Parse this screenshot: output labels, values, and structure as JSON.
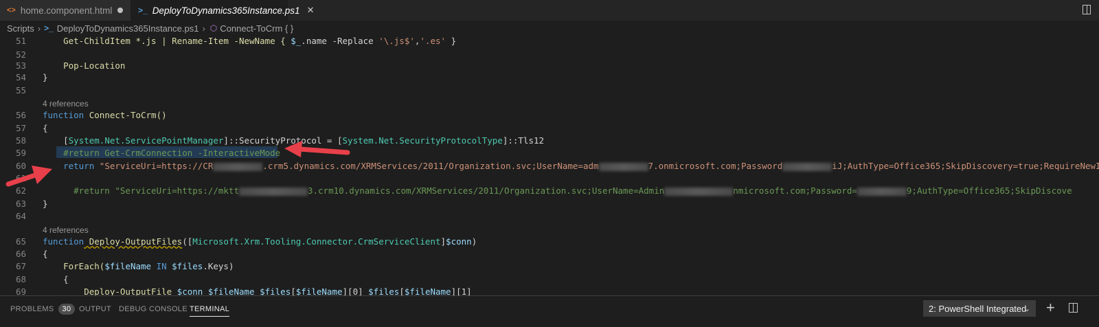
{
  "tabs": [
    {
      "label": "home.component.html",
      "icon": "html-file-icon",
      "modified": true
    },
    {
      "label": "DeployToDynamics365Instance.ps1",
      "icon": "powershell-file-icon",
      "active": true
    }
  ],
  "breadcrumb": {
    "items": [
      "Scripts",
      "DeployToDynamics365Instance.ps1",
      "Connect-ToCrm { }"
    ]
  },
  "code": {
    "refs": "4 references",
    "l51": "51",
    "l52": "52",
    "l53": "53",
    "l54": "54",
    "l55": "55",
    "l56": "56",
    "l57": "57",
    "l58": "58",
    "l59": "59",
    "l60": "60",
    "l61": "61",
    "l62": "62",
    "l63": "63",
    "l64": "64",
    "l65": "65",
    "l66": "66",
    "l67": "67",
    "l68": "68",
    "l69": "69",
    "t51a": "    Get-ChildItem *.js | Rename-Item -NewName { ",
    "t51b": "$_",
    "t51c": ".name -Replace ",
    "t51d": "'\\.js$'",
    "t51e": ",",
    "t51f": "'.es'",
    "t51g": " }",
    "t53": "    Pop-Location",
    "t54": "}",
    "t56a": "function",
    "t56b": " Connect-ToCrm()",
    "t57": "{",
    "t58a": "    [",
    "t58b": "System.Net.ServicePointManager",
    "t58c": "]::SecurityProtocol = [",
    "t58d": "System.Net.SecurityProtocolType",
    "t58e": "]::Tls12",
    "t59": "    #return Get-CrmConnection -InteractiveMode",
    "t60a": "    return ",
    "t60b": "\"ServiceUri=https://CR",
    "t60c": ".crm5.dynamics.com/XRMServices/2011/Organization.svc;UserName=adm",
    "t60d": "7.onmicrosoft.com;Password",
    "t60e": "iJ;AuthType=Office365;SkipDiscovery=true;RequireNewI",
    "t62a": "      #return \"ServiceUri=https://mktt",
    "t62b": "3.crm10.dynamics.com/XRMServices/2011/Organization.svc;UserName=Admin",
    "t62c": "nmicrosoft.com;Password=",
    "t62d": "9;AuthType=Office365;SkipDiscove",
    "t63": "}",
    "t65a": "function",
    "t65b": " Deploy-OutputFiles",
    "t65c": "([",
    "t65d": "Microsoft.Xrm.Tooling.Connector.CrmServiceClient",
    "t65e": "]",
    "t65f": "$conn",
    "t65g": ")",
    "t66": "{",
    "t67a": "    ForEach(",
    "t67b": "$fileName",
    "t67c": " IN ",
    "t67d": "$files",
    "t67e": ".Keys)",
    "t68": "    {",
    "t69a": "        Deploy-OutputFile ",
    "t69b": "$conn $fileName $files",
    "t69c": "[",
    "t69d": "$fileName",
    "t69e": "][0] ",
    "t69f": "$files",
    "t69g": "[",
    "t69h": "$fileName",
    "t69i": "][1]"
  },
  "panel": {
    "tabs": [
      "PROBLEMS",
      "OUTPUT",
      "DEBUG CONSOLE",
      "TERMINAL"
    ],
    "problems_count": "30",
    "terminal_select": "2: PowerShell Integrated",
    "plus": "+"
  },
  "colors": {
    "annotation_arrow": "#e8404a",
    "background": "#1e1e1e"
  }
}
